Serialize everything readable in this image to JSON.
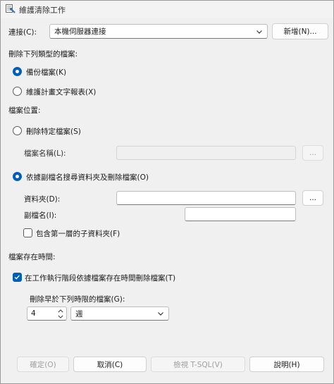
{
  "window": {
    "title": "維護清除工作"
  },
  "connection": {
    "label": "連接(C):",
    "selected": "本機伺服器連接",
    "new_button": "新增(N)..."
  },
  "delete_type": {
    "heading": "刪除下列類型的檔案:",
    "options": [
      {
        "label": "備份檔案(K)",
        "checked": true
      },
      {
        "label": "維護計畫文字報表(X)",
        "checked": false
      }
    ]
  },
  "file_location": {
    "heading": "檔案位置:",
    "specific_file": {
      "label": "刪除特定檔案(S)",
      "checked": false
    },
    "file_name_label": "檔案名稱(L):",
    "file_name_browse": "...",
    "by_extension": {
      "label": "依據副檔名搜尋資料夾及刪除檔案(O)",
      "checked": true
    },
    "folder_label": "資料夾(D):",
    "folder_value": "",
    "folder_browse": "...",
    "extension_label": "副檔名(I):",
    "extension_value": "",
    "include_subfolders": {
      "label": "包含第一層的子資料夾(F)",
      "checked": false
    }
  },
  "file_age": {
    "heading": "檔案存在時間:",
    "delete_by_age": {
      "label": "在工作執行階段依據檔案存在時間刪除檔案(T)",
      "checked": true
    },
    "older_than_label": "刪除早於下列時限的檔案(G):",
    "amount": "4",
    "unit": "週"
  },
  "buttons": {
    "ok": "確定(O)",
    "cancel": "取消(C)",
    "view_tsql": "檢視 T-SQL(V)",
    "help": "說明(H)"
  }
}
